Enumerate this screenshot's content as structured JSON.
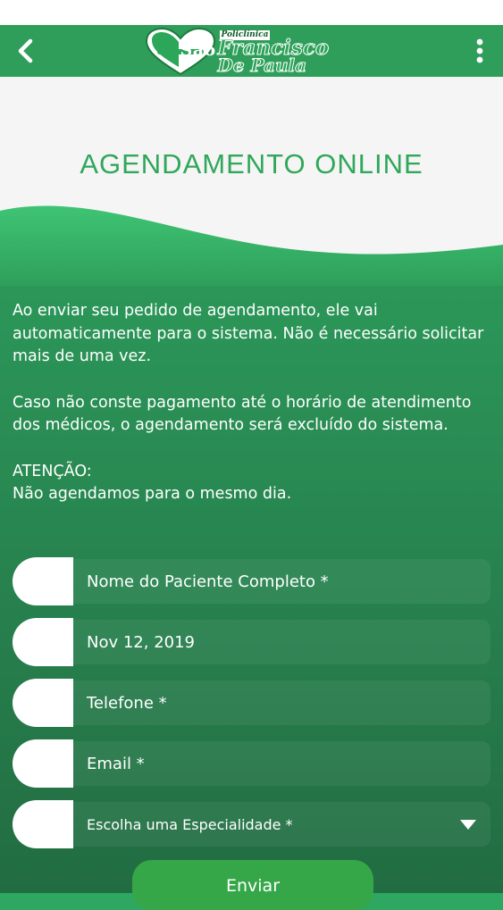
{
  "header": {
    "back_icon": "chevron-left-icon",
    "more_icon": "more-vertical-icon",
    "logo": {
      "top_label": "Policlínica",
      "sao": "São",
      "line1": "Francisco",
      "line2": "De Paula"
    }
  },
  "banner": {
    "title": "AGENDAMENTO ONLINE"
  },
  "info": {
    "paragraph1": "Ao enviar seu pedido de agendamento, ele vai automaticamente para o sistema. Não é necessário solicitar mais de uma vez.",
    "paragraph2": "Caso não conste pagamento até o horário de atendimento dos médicos, o agendamento será excluído do sistema.",
    "attention_label": "ATENÇÃO:",
    "attention_text": "Não agendamos para o mesmo dia."
  },
  "form": {
    "patient_name_placeholder": "Nome do Paciente Completo *",
    "date_value": "Nov 12, 2019",
    "phone_placeholder": "Telefone *",
    "email_placeholder": "Email *",
    "specialty_placeholder": "Escolha uma Especialidade *",
    "submit_label": "Enviar"
  },
  "colors": {
    "brand_green": "#2f9e5a",
    "button_green": "#36a749",
    "banner_title": "#30a75a"
  }
}
